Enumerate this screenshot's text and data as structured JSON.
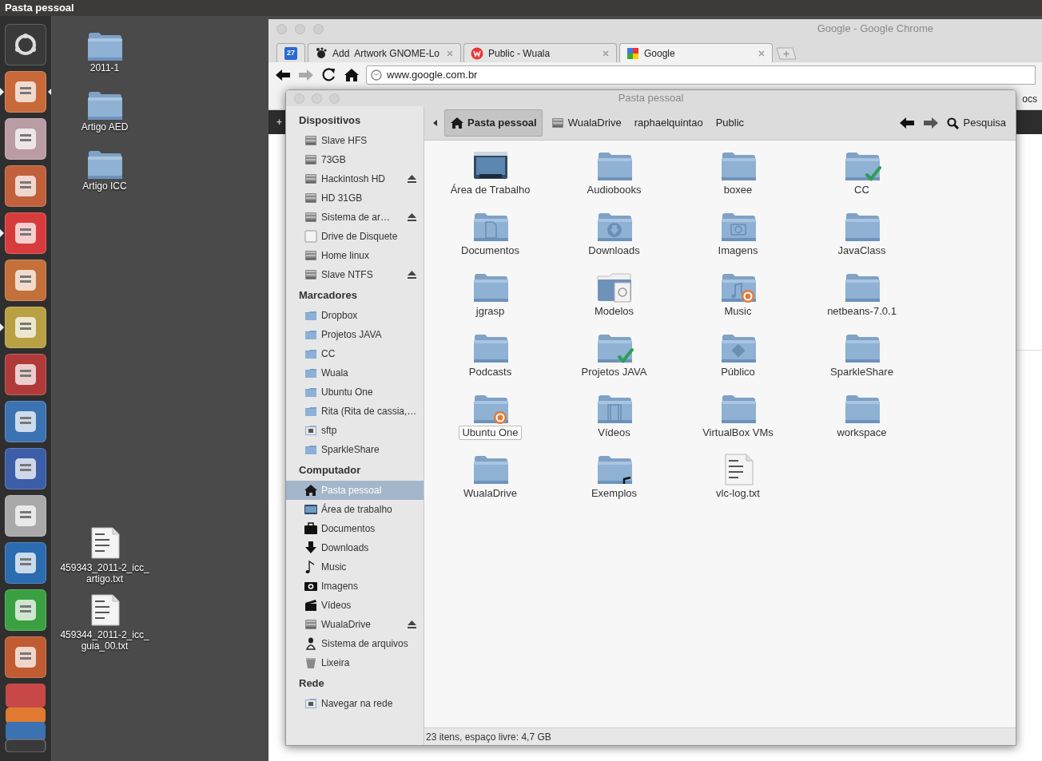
{
  "top_panel": {
    "title": "Pasta pessoal"
  },
  "launcher": [
    {
      "kind": "dash",
      "running": false,
      "active": false,
      "color": "#3a3a3a"
    },
    {
      "kind": "app",
      "running": true,
      "active": true,
      "color": "#c8693a"
    },
    {
      "kind": "app",
      "running": false,
      "active": false,
      "color": "#b99ca4"
    },
    {
      "kind": "app",
      "running": false,
      "active": false,
      "color": "#c2603c"
    },
    {
      "kind": "app",
      "running": true,
      "active": false,
      "color": "#d83b3b"
    },
    {
      "kind": "app",
      "running": false,
      "active": false,
      "color": "#c4703a"
    },
    {
      "kind": "app",
      "running": true,
      "active": false,
      "color": "#b9a042"
    },
    {
      "kind": "app",
      "running": false,
      "active": false,
      "color": "#b03a3a"
    },
    {
      "kind": "app",
      "running": false,
      "active": false,
      "color": "#3b72b2"
    },
    {
      "kind": "app",
      "running": false,
      "active": false,
      "color": "#3c5ea8"
    },
    {
      "kind": "app",
      "running": false,
      "active": false,
      "color": "#a9a9a9"
    },
    {
      "kind": "app",
      "running": false,
      "active": false,
      "color": "#2b6bb0"
    },
    {
      "kind": "app",
      "running": false,
      "active": false,
      "color": "#3ba041"
    },
    {
      "kind": "app",
      "running": false,
      "active": false,
      "color": "#c05b32"
    }
  ],
  "desktop_icons": [
    {
      "kind": "folder",
      "label": "2011-1"
    },
    {
      "kind": "folder",
      "label": "Artigo AED"
    },
    {
      "kind": "folder",
      "label": "Artigo ICC"
    },
    {
      "kind": "text",
      "label": "459343_2011-2_icc_artigo.txt"
    },
    {
      "kind": "text",
      "label": "459344_2011-2_icc_guia_00.txt"
    }
  ],
  "chrome": {
    "title": "Google - Google Chrome",
    "tabs": [
      {
        "kind": "pinned",
        "label": "27",
        "selected": false
      },
      {
        "kind": "gnome",
        "label": "Add  Artwork GNOME-Lo",
        "selected": false
      },
      {
        "kind": "wuala",
        "label": "Public - Wuala",
        "selected": false
      },
      {
        "kind": "google",
        "label": "Google",
        "selected": true
      }
    ],
    "url": "www.google.com.br",
    "bookmark_fragment": "ocs",
    "bar_fragment": "+"
  },
  "files": {
    "title": "Pasta pessoal",
    "sidebar": [
      {
        "header": "Dispositivos",
        "items": [
          {
            "kind": "drive",
            "label": "Slave HFS",
            "eject": false,
            "selected": false
          },
          {
            "kind": "drive",
            "label": "73GB",
            "eject": false,
            "selected": false
          },
          {
            "kind": "drive",
            "label": "Hackintosh HD",
            "eject": true,
            "selected": false
          },
          {
            "kind": "drive",
            "label": "HD 31GB",
            "eject": false,
            "selected": false
          },
          {
            "kind": "drive",
            "label": "Sistema de ar…",
            "eject": true,
            "selected": false
          },
          {
            "kind": "floppy",
            "label": "Drive de Disquete",
            "eject": false,
            "selected": false
          },
          {
            "kind": "drive",
            "label": "Home linux",
            "eject": false,
            "selected": false
          },
          {
            "kind": "drive",
            "label": "Slave NTFS",
            "eject": true,
            "selected": false
          }
        ]
      },
      {
        "header": "Marcadores",
        "items": [
          {
            "kind": "folder",
            "label": "Dropbox",
            "eject": false,
            "selected": false
          },
          {
            "kind": "folder",
            "label": "Projetos JAVA",
            "eject": false,
            "selected": false
          },
          {
            "kind": "folder",
            "label": "CC",
            "eject": false,
            "selected": false
          },
          {
            "kind": "folder",
            "label": "Wuala",
            "eject": false,
            "selected": false
          },
          {
            "kind": "folder",
            "label": "Ubuntu One",
            "eject": false,
            "selected": false
          },
          {
            "kind": "folder",
            "label": "Rita (Rita de cassia,…",
            "eject": false,
            "selected": false
          },
          {
            "kind": "network",
            "label": "sftp",
            "eject": false,
            "selected": false
          },
          {
            "kind": "folder",
            "label": "SparkleShare",
            "eject": false,
            "selected": false
          }
        ]
      },
      {
        "header": "Computador",
        "items": [
          {
            "kind": "home",
            "label": "Pasta pessoal",
            "eject": false,
            "selected": true
          },
          {
            "kind": "desktop",
            "label": "Área de trabalho",
            "eject": false,
            "selected": false
          },
          {
            "kind": "documents",
            "label": "Documentos",
            "eject": false,
            "selected": false
          },
          {
            "kind": "downloads",
            "label": "Downloads",
            "eject": false,
            "selected": false
          },
          {
            "kind": "music",
            "label": "Music",
            "eject": false,
            "selected": false
          },
          {
            "kind": "images",
            "label": "Imagens",
            "eject": false,
            "selected": false
          },
          {
            "kind": "videos",
            "label": "Vídeos",
            "eject": false,
            "selected": false
          },
          {
            "kind": "drive",
            "label": "WualaDrive",
            "eject": true,
            "selected": false
          },
          {
            "kind": "filesystem",
            "label": "Sistema de arquivos",
            "eject": false,
            "selected": false
          },
          {
            "kind": "trash",
            "label": "Lixeira",
            "eject": false,
            "selected": false
          }
        ]
      },
      {
        "header": "Rede",
        "items": [
          {
            "kind": "network",
            "label": "Navegar na rede",
            "eject": false,
            "selected": false
          }
        ]
      }
    ],
    "path": [
      {
        "kind": "home",
        "label": "Pasta pessoal",
        "selected": true
      },
      {
        "kind": "drive",
        "label": "WualaDrive",
        "selected": false
      },
      {
        "kind": "plain",
        "label": "raphaelquintao",
        "selected": false
      },
      {
        "kind": "plain",
        "label": "Public",
        "selected": false
      }
    ],
    "search": "Pesquisa",
    "items": [
      {
        "kind": "desktop",
        "label": "Área de Trabalho",
        "selected": false
      },
      {
        "kind": "folder",
        "label": "Audiobooks",
        "selected": false
      },
      {
        "kind": "folder",
        "label": "boxee",
        "selected": false
      },
      {
        "kind": "folder",
        "label": "CC",
        "synced": true,
        "selected": false
      },
      {
        "kind": "documents",
        "label": "Documentos",
        "selected": false
      },
      {
        "kind": "downloads",
        "label": "Downloads",
        "selected": false
      },
      {
        "kind": "images",
        "label": "Imagens",
        "selected": false
      },
      {
        "kind": "folder",
        "label": "JavaClass",
        "selected": false
      },
      {
        "kind": "folder",
        "label": "jgrasp",
        "selected": false
      },
      {
        "kind": "templates",
        "label": "Modelos",
        "selected": false
      },
      {
        "kind": "music",
        "label": "Music",
        "syncing": true,
        "selected": false
      },
      {
        "kind": "folder",
        "label": "netbeans-7.0.1",
        "selected": false
      },
      {
        "kind": "folder",
        "label": "Podcasts",
        "selected": false
      },
      {
        "kind": "folder",
        "label": "Projetos JAVA",
        "synced": true,
        "selected": false
      },
      {
        "kind": "public",
        "label": "Público",
        "selected": false
      },
      {
        "kind": "folder",
        "label": "SparkleShare",
        "selected": false
      },
      {
        "kind": "folder",
        "label": "Ubuntu One",
        "syncing": true,
        "selected": true
      },
      {
        "kind": "videos",
        "label": "Vídeos",
        "selected": false
      },
      {
        "kind": "folder",
        "label": "VirtualBox VMs",
        "selected": false
      },
      {
        "kind": "folder",
        "label": "workspace",
        "selected": false
      },
      {
        "kind": "folder",
        "label": "WualaDrive",
        "selected": false
      },
      {
        "kind": "folder",
        "label": "Exemplos",
        "shortcut": true,
        "selected": false
      },
      {
        "kind": "text",
        "label": "vlc-log.txt",
        "selected": false
      }
    ],
    "status": "23 itens, espaço livre: 4,7 GB"
  }
}
